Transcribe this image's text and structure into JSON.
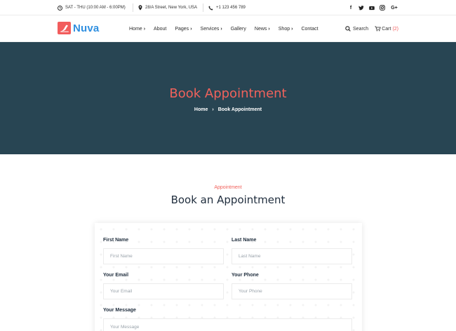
{
  "topbar": {
    "hours": "SAT - THU (10:00 AM - 6:00PM)",
    "address": "28/A Street, New York, USA",
    "phone": "+1 123 456 789",
    "social": [
      "facebook-icon",
      "twitter-icon",
      "youtube-icon",
      "instagram-icon",
      "google-plus-icon"
    ]
  },
  "header": {
    "logo_text": "Nuva",
    "nav": [
      {
        "label": "Home",
        "dropdown": true
      },
      {
        "label": "About",
        "dropdown": false
      },
      {
        "label": "Pages",
        "dropdown": true
      },
      {
        "label": "Services",
        "dropdown": true
      },
      {
        "label": "Gallery",
        "dropdown": false
      },
      {
        "label": "News",
        "dropdown": true
      },
      {
        "label": "Shop",
        "dropdown": true
      },
      {
        "label": "Contact",
        "dropdown": false
      }
    ],
    "search_label": "Search",
    "cart_label": "Cart",
    "cart_count": "(2)"
  },
  "hero": {
    "title": "Book Appointment",
    "breadcrumb_home": "Home",
    "breadcrumb_current": "Book Appointment"
  },
  "section": {
    "subtitle": "Appointment",
    "title": "Book an Appointment"
  },
  "form": {
    "first_name_label": "First Name",
    "first_name_placeholder": "First Name",
    "last_name_label": "Last Name",
    "last_name_placeholder": "Last Name",
    "email_label": "Your Email",
    "email_placeholder": "Your Email",
    "phone_label": "Your Phone",
    "phone_placeholder": "Your Phone",
    "message_label": "Your Message",
    "message_placeholder": "Your Message"
  },
  "colors": {
    "accent": "#f0625c",
    "hero_bg": "#284553",
    "logo_blue": "#2f8fe0"
  }
}
